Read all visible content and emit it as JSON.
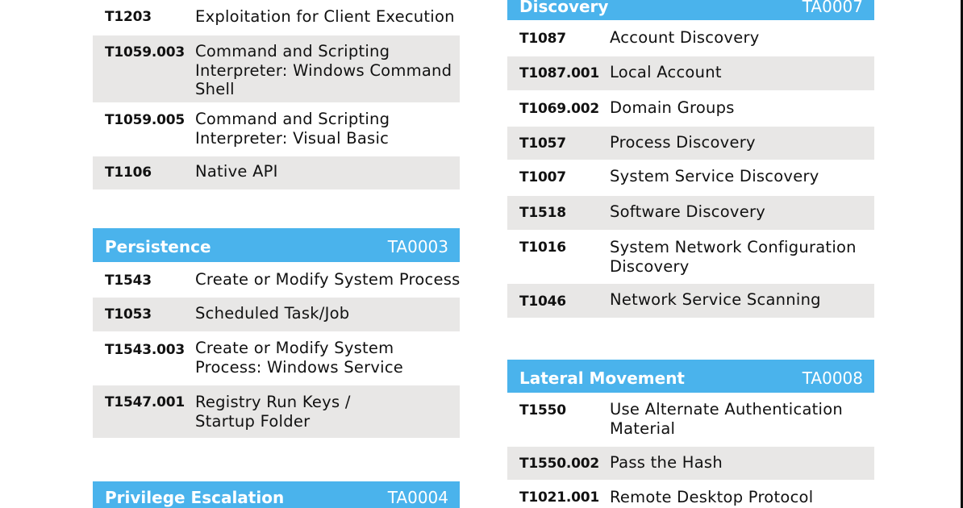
{
  "left_column": {
    "rows_top": [
      {
        "id": "T1203",
        "name": [
          "Exploitation for Client Execution"
        ]
      },
      {
        "id": "T1059.003",
        "name": [
          "Command and Scripting",
          "Interpreter: Windows Command",
          "Shell"
        ]
      },
      {
        "id": "T1059.005",
        "name": [
          "Command and Scripting",
          "Interpreter: Visual Basic"
        ]
      },
      {
        "id": "T1106",
        "name": [
          "Native API"
        ]
      }
    ],
    "persistence": {
      "title": "Persistence",
      "code": "TA0003",
      "rows": [
        {
          "id": "T1543",
          "name": [
            "Create or Modify System Process"
          ]
        },
        {
          "id": "T1053",
          "name": [
            "Scheduled Task/Job"
          ]
        },
        {
          "id": "T1543.003",
          "name": [
            "Create or Modify System",
            "Process: Windows Service"
          ]
        },
        {
          "id": "T1547.001",
          "name": [
            "Registry Run Keys /",
            "Startup Folder"
          ]
        }
      ]
    },
    "privilege_escalation": {
      "title": "Privilege Escalation",
      "code": "TA0004"
    }
  },
  "right_column": {
    "discovery": {
      "title": "Discovery",
      "code": "TA0007",
      "rows": [
        {
          "id": "T1087",
          "name": [
            "Account Discovery"
          ]
        },
        {
          "id": "T1087.001",
          "name": [
            "Local Account"
          ]
        },
        {
          "id": "T1069.002",
          "name": [
            "Domain Groups"
          ]
        },
        {
          "id": "T1057",
          "name": [
            "Process Discovery"
          ]
        },
        {
          "id": "T1007",
          "name": [
            "System Service Discovery"
          ]
        },
        {
          "id": "T1518",
          "name": [
            "Software Discovery"
          ]
        },
        {
          "id": "T1016",
          "name": [
            "System Network Configuration",
            "Discovery"
          ]
        },
        {
          "id": "T1046",
          "name": [
            "Network Service Scanning"
          ]
        }
      ]
    },
    "lateral_movement": {
      "title": "Lateral Movement",
      "code": "TA0008",
      "rows": [
        {
          "id": "T1550",
          "name": [
            "Use Alternate Authentication",
            "Material"
          ]
        },
        {
          "id": "T1550.002",
          "name": [
            "Pass the Hash"
          ]
        },
        {
          "id": "T1021.001",
          "name": [
            "Remote Desktop Protocol"
          ]
        }
      ]
    }
  },
  "colors": {
    "header_bg": "#4ab3ec",
    "row_shade": "#e8e7e6",
    "text": "#111111"
  }
}
